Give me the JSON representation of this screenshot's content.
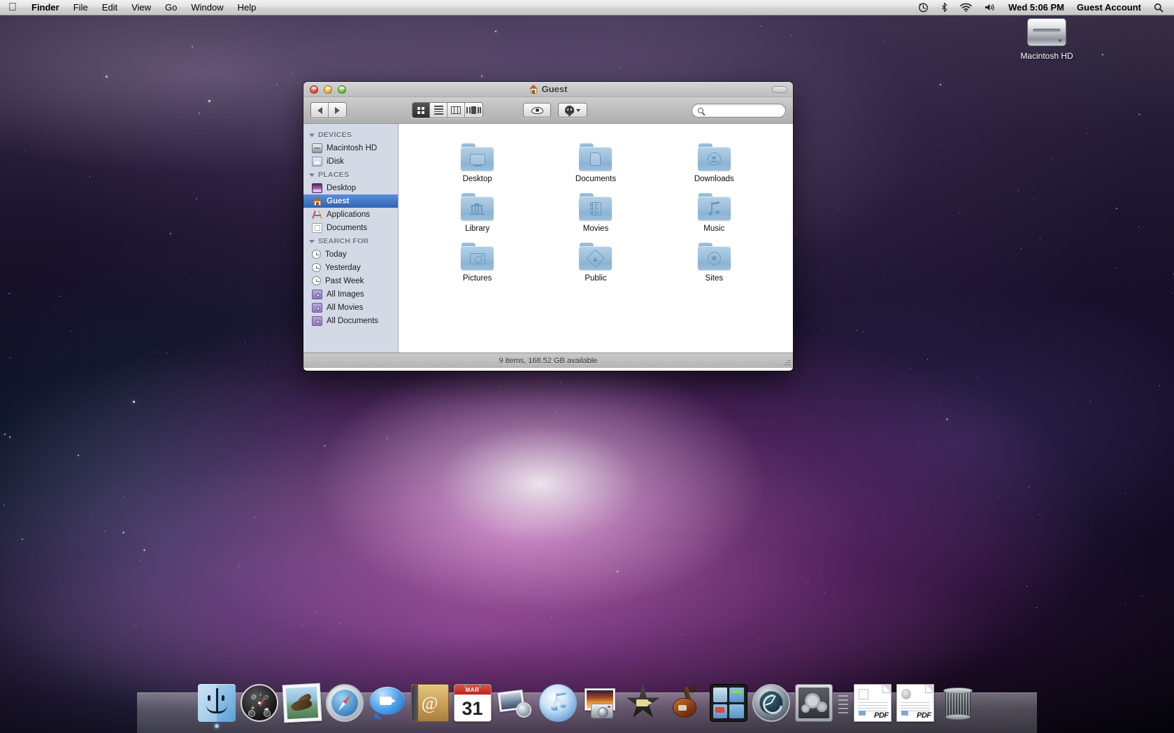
{
  "menubar": {
    "apple_glyph": "",
    "items": [
      "Finder",
      "File",
      "Edit",
      "View",
      "Go",
      "Window",
      "Help"
    ],
    "status": {
      "timemachine_icon": "time-machine-icon",
      "bluetooth_glyph": "✳",
      "wifi_icon": "wifi-icon",
      "volume_icon": "volume-icon",
      "clock": "Wed 5:06 PM",
      "user": "Guest Account",
      "spotlight_icon": "spotlight-icon"
    }
  },
  "desktop": {
    "hd_icon_label": "Macintosh HD"
  },
  "finder": {
    "title": "Guest",
    "toolbar": {
      "back_label": "Back",
      "forward_label": "Forward",
      "view_icon": "Icon View",
      "view_list": "List View",
      "view_column": "Column View",
      "view_coverflow": "Cover Flow View",
      "quicklook_label": "Quick Look",
      "action_label": "Action"
    },
    "search": {
      "placeholder": "",
      "value": ""
    },
    "sidebar": {
      "sections": [
        {
          "header": "DEVICES",
          "items": [
            {
              "label": "Macintosh HD",
              "icon": "harddisk-icon"
            },
            {
              "label": "iDisk",
              "icon": "idisk-icon"
            }
          ]
        },
        {
          "header": "PLACES",
          "items": [
            {
              "label": "Desktop",
              "icon": "desktop-icon"
            },
            {
              "label": "Guest",
              "icon": "home-icon",
              "selected": true
            },
            {
              "label": "Applications",
              "icon": "applications-icon"
            },
            {
              "label": "Documents",
              "icon": "documents-icon"
            }
          ]
        },
        {
          "header": "SEARCH FOR",
          "items": [
            {
              "label": "Today",
              "icon": "clock-icon"
            },
            {
              "label": "Yesterday",
              "icon": "clock-icon"
            },
            {
              "label": "Past Week",
              "icon": "clock-icon"
            },
            {
              "label": "All Images",
              "icon": "smart-folder-icon"
            },
            {
              "label": "All Movies",
              "icon": "smart-folder-icon"
            },
            {
              "label": "All Documents",
              "icon": "smart-folder-icon"
            }
          ]
        }
      ]
    },
    "files": [
      {
        "name": "Desktop",
        "emblem": "screen"
      },
      {
        "name": "Documents",
        "emblem": "doc"
      },
      {
        "name": "Downloads",
        "emblem": "download"
      },
      {
        "name": "Library",
        "emblem": "library"
      },
      {
        "name": "Movies",
        "emblem": "film"
      },
      {
        "name": "Music",
        "emblem": "note"
      },
      {
        "name": "Pictures",
        "emblem": "camera"
      },
      {
        "name": "Public",
        "emblem": "public"
      },
      {
        "name": "Sites",
        "emblem": "sites"
      }
    ],
    "status": "9 items, 168.52 GB available"
  },
  "dock": {
    "items": [
      {
        "name": "Finder",
        "icon": "finder-icon",
        "running": true
      },
      {
        "name": "Dashboard",
        "icon": "dashboard-icon",
        "running": false
      },
      {
        "name": "Mail",
        "icon": "mail-icon",
        "running": false
      },
      {
        "name": "Safari",
        "icon": "safari-icon",
        "running": false
      },
      {
        "name": "iChat",
        "icon": "ichat-icon",
        "running": false
      },
      {
        "name": "Address Book",
        "icon": "address-book-icon",
        "running": false
      },
      {
        "name": "iCal",
        "icon": "ical-icon",
        "running": false
      },
      {
        "name": "iPhoto",
        "icon": "iphoto-icon",
        "running": false
      },
      {
        "name": "iTunes",
        "icon": "itunes-icon",
        "running": false
      },
      {
        "name": "Photo Booth",
        "icon": "photobooth-icon",
        "running": false
      },
      {
        "name": "iMovie",
        "icon": "imovie-icon",
        "running": false
      },
      {
        "name": "GarageBand",
        "icon": "garageband-icon",
        "running": false
      },
      {
        "name": "Spaces",
        "icon": "spaces-icon",
        "running": false
      },
      {
        "name": "Time Machine",
        "icon": "time-machine-icon",
        "running": false
      },
      {
        "name": "System Preferences",
        "icon": "system-prefs-icon",
        "running": false
      }
    ],
    "documents": [
      {
        "name": "PDF Document",
        "icon": "pdf-icon",
        "tag": "PDF"
      },
      {
        "name": "PDF Document",
        "icon": "pdf-icon",
        "tag": "PDF"
      }
    ],
    "trash": {
      "name": "Trash",
      "icon": "trash-icon"
    },
    "ical_month": "MAR",
    "ical_day": "31"
  }
}
